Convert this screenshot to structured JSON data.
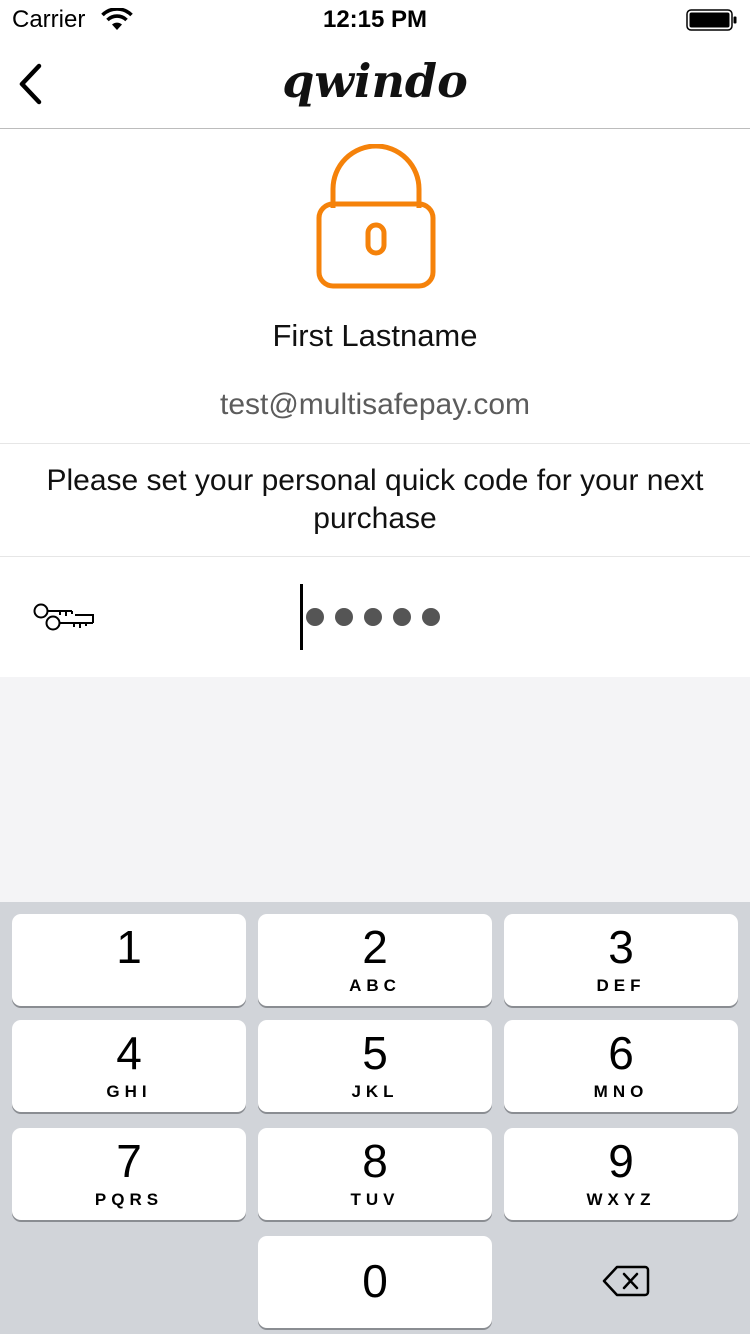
{
  "status_bar": {
    "carrier": "Carrier",
    "time": "12:15 PM",
    "wifi_icon": "wifi-icon",
    "battery_icon": "battery-icon"
  },
  "nav": {
    "back_icon": "chevron-left-icon",
    "brand": "qwindo"
  },
  "profile": {
    "lock_icon": "lock-icon",
    "lock_color": "#F5820A",
    "name": "First Lastname",
    "email": "test@multisafepay.com"
  },
  "instruction": "Please set your personal quick code for your next purchase",
  "code_input": {
    "key_icon": "key-icon",
    "filled_count": 5,
    "dot_color": "#555555"
  },
  "keypad": {
    "keys": [
      {
        "digit": "1",
        "letters": ""
      },
      {
        "digit": "2",
        "letters": "ABC"
      },
      {
        "digit": "3",
        "letters": "DEF"
      },
      {
        "digit": "4",
        "letters": "GHI"
      },
      {
        "digit": "5",
        "letters": "JKL"
      },
      {
        "digit": "6",
        "letters": "MNO"
      },
      {
        "digit": "7",
        "letters": "PQRS"
      },
      {
        "digit": "8",
        "letters": "TUV"
      },
      {
        "digit": "9",
        "letters": "WXYZ"
      },
      {
        "digit": "0",
        "letters": ""
      }
    ],
    "backspace_icon": "backspace-icon"
  }
}
